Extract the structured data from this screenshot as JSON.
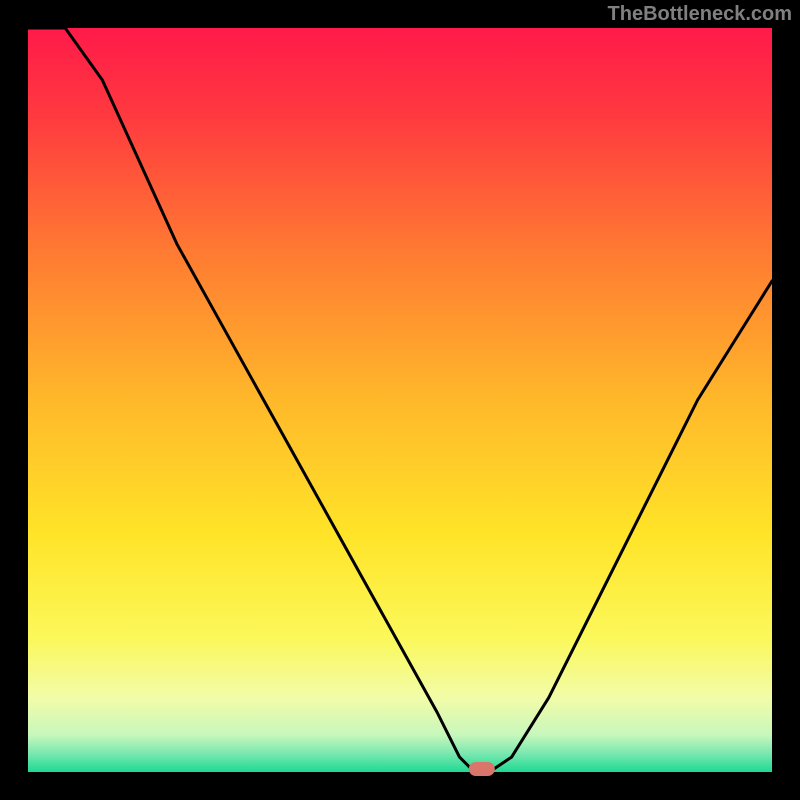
{
  "watermark": "TheBottleneck.com",
  "chart_data": {
    "type": "line",
    "title": "",
    "xlabel": "",
    "ylabel": "",
    "xlim": [
      0,
      100
    ],
    "ylim": [
      0,
      100
    ],
    "x": [
      0,
      5,
      10,
      15,
      20,
      25,
      30,
      35,
      40,
      45,
      50,
      55,
      58,
      60,
      62,
      65,
      70,
      75,
      80,
      85,
      90,
      95,
      100
    ],
    "values": [
      115,
      104,
      93,
      82,
      71,
      62,
      53,
      44,
      35,
      26,
      17,
      8,
      2,
      0,
      0,
      2,
      10,
      20,
      30,
      40,
      50,
      58,
      66
    ],
    "marker": {
      "x": 61,
      "y": 0,
      "color": "#d9756b",
      "shape": "rounded-rect"
    },
    "background": {
      "type": "gradient",
      "stops": [
        {
          "pos": 0,
          "color": "#ff1a4a"
        },
        {
          "pos": 0.12,
          "color": "#ff3a3f"
        },
        {
          "pos": 0.3,
          "color": "#ff7a32"
        },
        {
          "pos": 0.5,
          "color": "#ffb82a"
        },
        {
          "pos": 0.68,
          "color": "#ffe428"
        },
        {
          "pos": 0.82,
          "color": "#fbf85a"
        },
        {
          "pos": 0.9,
          "color": "#f2fca8"
        },
        {
          "pos": 0.95,
          "color": "#c8f7bc"
        },
        {
          "pos": 0.975,
          "color": "#7ae8b0"
        },
        {
          "pos": 1.0,
          "color": "#1ed993"
        }
      ]
    },
    "frame_color": "#000000",
    "line_color": "#000000"
  }
}
